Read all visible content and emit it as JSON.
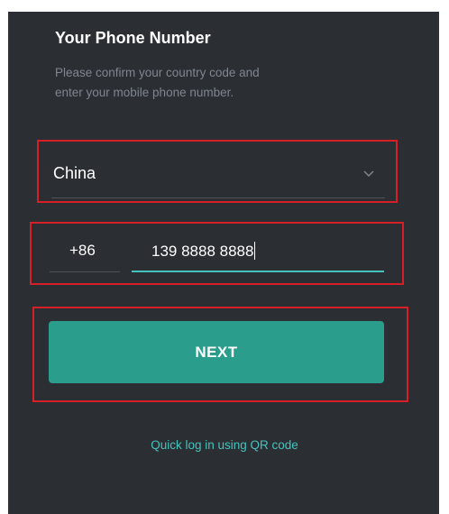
{
  "login": {
    "title": "Your Phone Number",
    "subtitle_line1": "Please confirm your country code and",
    "subtitle_line2": "enter your mobile phone number.",
    "country": {
      "selected": "China",
      "icon": "chevron-down-icon"
    },
    "country_code": "+86",
    "phone_number": "139 8888 8888",
    "next_label": "NEXT",
    "qr_link": "Quick log in using QR code"
  },
  "colors": {
    "background": "#2b2e33",
    "accent_button": "#2a9d8c",
    "accent_text": "#44c4bd",
    "highlight_border": "#d61f26"
  }
}
